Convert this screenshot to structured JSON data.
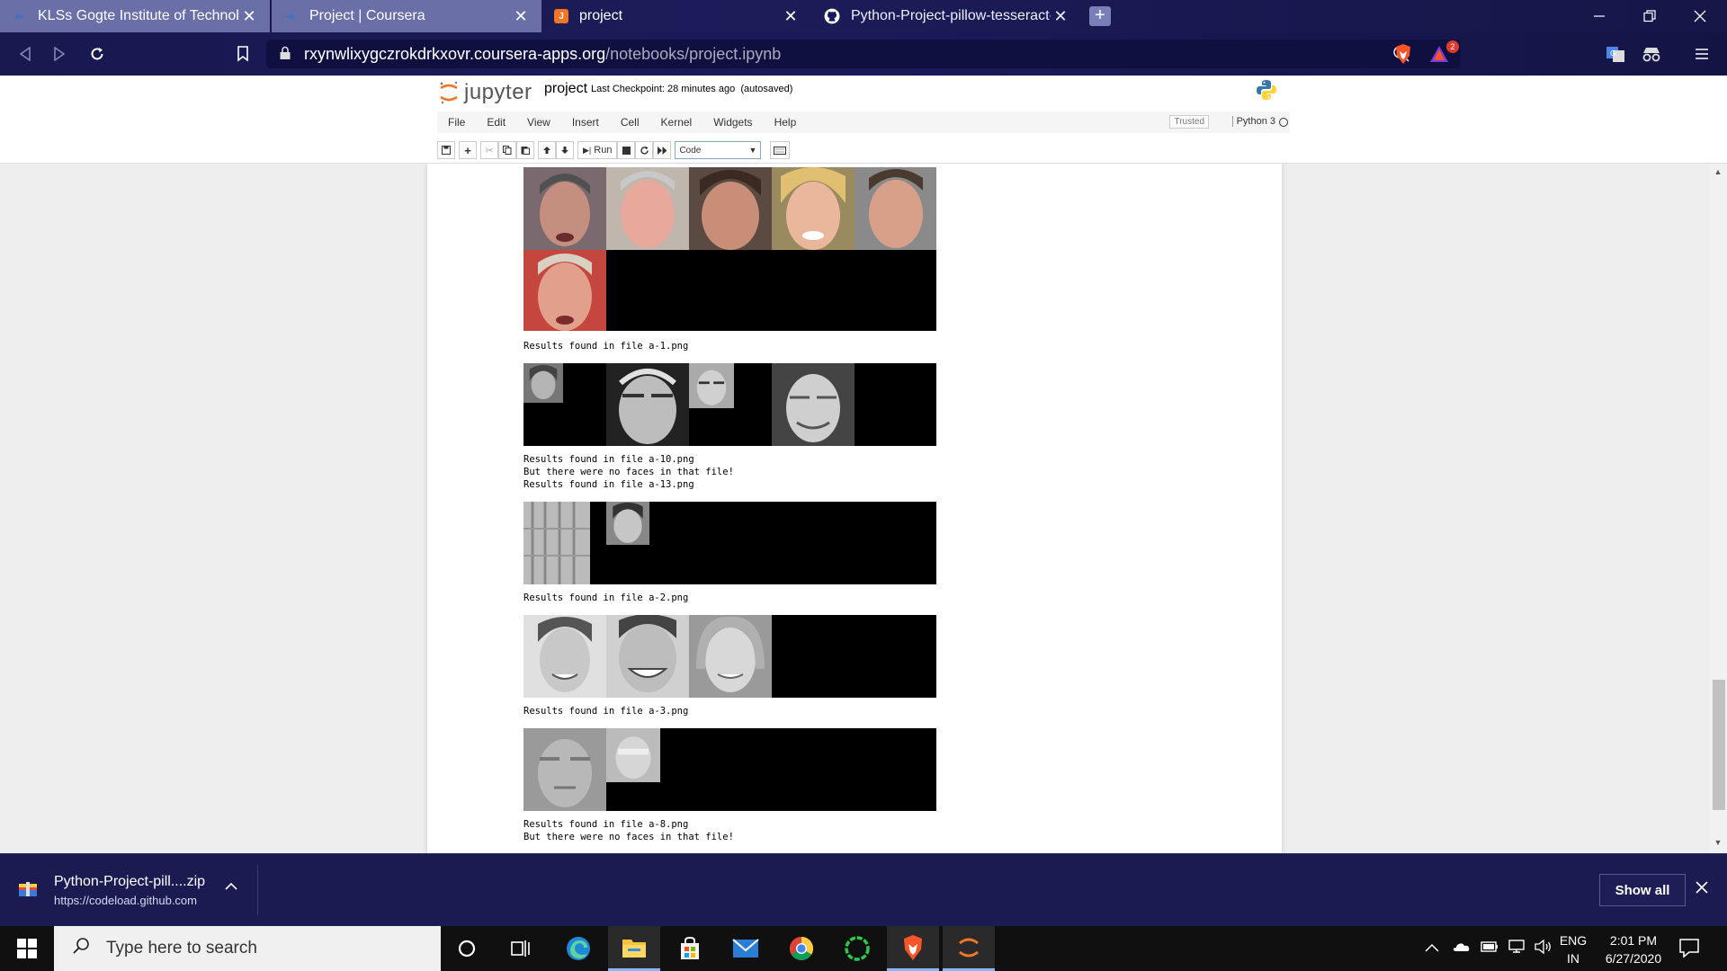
{
  "browser": {
    "tabs": [
      {
        "title": "KLSs Gogte Institute of Technolog",
        "icon": "coursera-infinity-icon",
        "active": false
      },
      {
        "title": "Project | Coursera",
        "icon": "coursera-infinity-icon",
        "active": false
      },
      {
        "title": "project",
        "icon": "jupyter-notebook-icon",
        "active": true
      },
      {
        "title": "Python-Project-pillow-tesseract-a",
        "icon": "github-icon",
        "active": false
      }
    ],
    "new_tab_label": "+",
    "close_glyph": "✕",
    "url_host": "rxynwlixygczrokdrkxovr.coursera-apps.org",
    "url_path": "/notebooks/project.ipynb",
    "brave_badge_count": "2",
    "accent_color": "#1a1a5a"
  },
  "jupyter": {
    "logo_text": "jupyter",
    "notebook_name": "project",
    "checkpoint": "Last Checkpoint: 28 minutes ago",
    "autosave": "(autosaved)",
    "menu": [
      "File",
      "Edit",
      "View",
      "Insert",
      "Cell",
      "Kernel",
      "Widgets",
      "Help"
    ],
    "trusted": "Trusted",
    "kernel": "Python 3",
    "run_label": "Run",
    "cell_type": "Code"
  },
  "output": {
    "lines": [
      "Results found in file a-1.png",
      "Results found in file a-10.png\nBut there were no faces in that file!\nResults found in file a-13.png",
      "Results found in file a-2.png",
      "Results found in file a-3.png",
      "Results found in file a-8.png\nBut there were no faces in that file!"
    ]
  },
  "downloads": {
    "filename": "Python-Project-pill....zip",
    "source": "https://codeload.github.com",
    "show_all": "Show all"
  },
  "taskbar": {
    "search_placeholder": "Type here to search",
    "lang_line1": "ENG",
    "lang_line2": "IN",
    "time": "2:01 PM",
    "date": "6/27/2020"
  }
}
